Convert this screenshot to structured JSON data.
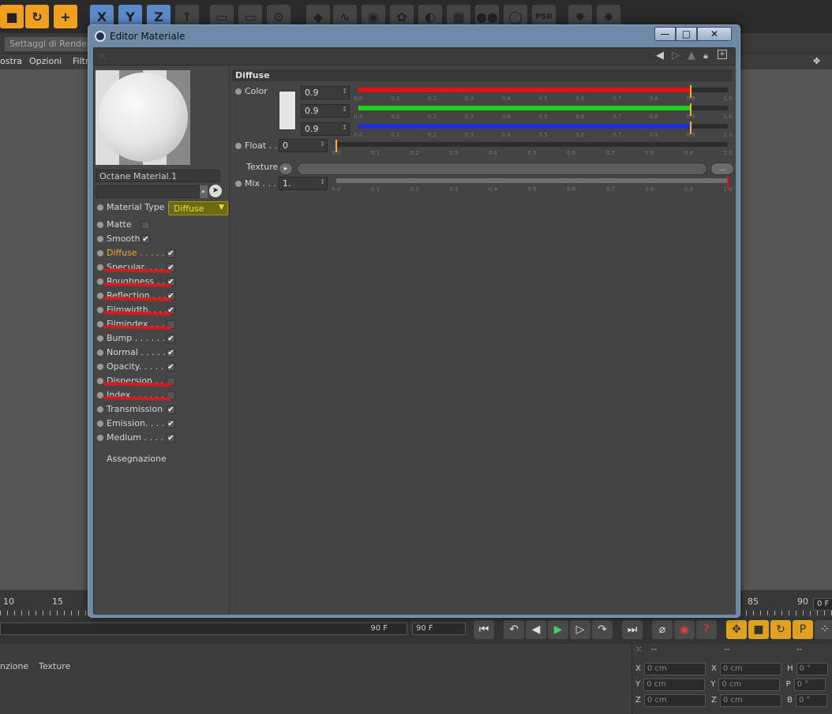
{
  "background": {
    "tab_label": "Settaggi di Renderi",
    "menu": [
      "ostra",
      "Opzioni",
      "Filtr"
    ],
    "ruler_labels": [
      "10",
      "15",
      "85",
      "90"
    ],
    "frame_field": "0 F",
    "end_frame": "90 F",
    "end_frame_field": "90 F",
    "lower_labels": [
      "nzione",
      "Texture"
    ],
    "coords": {
      "header": [
        "--",
        "--",
        "--"
      ],
      "rows": [
        {
          "a": "X",
          "av": "0 cm",
          "b": "X",
          "bv": "0 cm",
          "c": "H",
          "cv": "0 °"
        },
        {
          "a": "Y",
          "av": "0 cm",
          "b": "Y",
          "bv": "0 cm",
          "c": "P",
          "cv": "0 °"
        },
        {
          "a": "Z",
          "av": "0 cm",
          "b": "Z",
          "bv": "0 cm",
          "c": "B",
          "cv": "0 °"
        }
      ]
    },
    "toolbar_glyphs": {
      "x": "X",
      "y": "Y",
      "z": "Z",
      "psr": "PSR"
    }
  },
  "dialog": {
    "title": "Editor Materiale",
    "minimize": "—",
    "maximize": "□",
    "close": "✕",
    "material_name": "Octane Material.1",
    "material_type_label": "Material Type",
    "material_type_value": "Diffuse",
    "channels": [
      {
        "label": "Matte",
        "checked": false,
        "struck": false,
        "active": false
      },
      {
        "label": "Smooth",
        "checked": true,
        "struck": false,
        "active": false
      },
      {
        "label": "Diffuse . . . . . .",
        "checked": true,
        "struck": false,
        "active": true
      },
      {
        "label": "Specular. . . . .",
        "checked": true,
        "struck": true,
        "active": false
      },
      {
        "label": "Roughness . . .",
        "checked": true,
        "struck": true,
        "active": false
      },
      {
        "label": "Reflection . . . .",
        "checked": true,
        "struck": true,
        "active": false
      },
      {
        "label": "Filmwidth. . . .",
        "checked": true,
        "struck": true,
        "active": false
      },
      {
        "label": "Filmindex . . . .",
        "checked": false,
        "struck": true,
        "active": false
      },
      {
        "label": "Bump . . . . . .",
        "checked": true,
        "struck": false,
        "active": false
      },
      {
        "label": "Normal . . . . .",
        "checked": true,
        "struck": false,
        "active": false
      },
      {
        "label": "Opacity. . . . .",
        "checked": true,
        "struck": false,
        "active": false
      },
      {
        "label": "Dispersion . . .",
        "checked": false,
        "struck": true,
        "active": false
      },
      {
        "label": "Index . . . . . .",
        "checked": false,
        "struck": true,
        "active": false
      },
      {
        "label": "Transmission",
        "checked": true,
        "struck": false,
        "active": false
      },
      {
        "label": "Emission. . . .",
        "checked": true,
        "struck": false,
        "active": false
      },
      {
        "label": "Medium . . . .",
        "checked": true,
        "struck": false,
        "active": false
      }
    ],
    "assign_label": "Assegnazione",
    "section_title": "Diffuse",
    "color_label": "Color",
    "color_values": [
      "0.9",
      "0.9",
      "0.9"
    ],
    "float_label": "Float . .",
    "float_value": "0",
    "texture_label": "Texture",
    "texture_more": "...",
    "mix_label": "Mix . . . .",
    "mix_value": "1.",
    "scale_ticks": [
      "0.0",
      "0.1",
      "0.2",
      "0.3",
      "0.4",
      "0.5",
      "0.6",
      "0.7",
      "0.8",
      "0.9",
      "1.0"
    ],
    "sliders": {
      "red": {
        "value": 0.9,
        "color": "#e01414"
      },
      "green": {
        "value": 0.9,
        "color": "#1ecf1e"
      },
      "blue": {
        "value": 0.9,
        "color": "#1a2fd8"
      },
      "float": {
        "value": 0.0,
        "color": "#2d2d2d"
      },
      "mix": {
        "value": 1.0,
        "color": "#6f6f6f"
      }
    },
    "colors": {
      "accent": "#f5a623",
      "strike": "#d81a1a",
      "material_type_bg": "#6b6b12"
    }
  }
}
